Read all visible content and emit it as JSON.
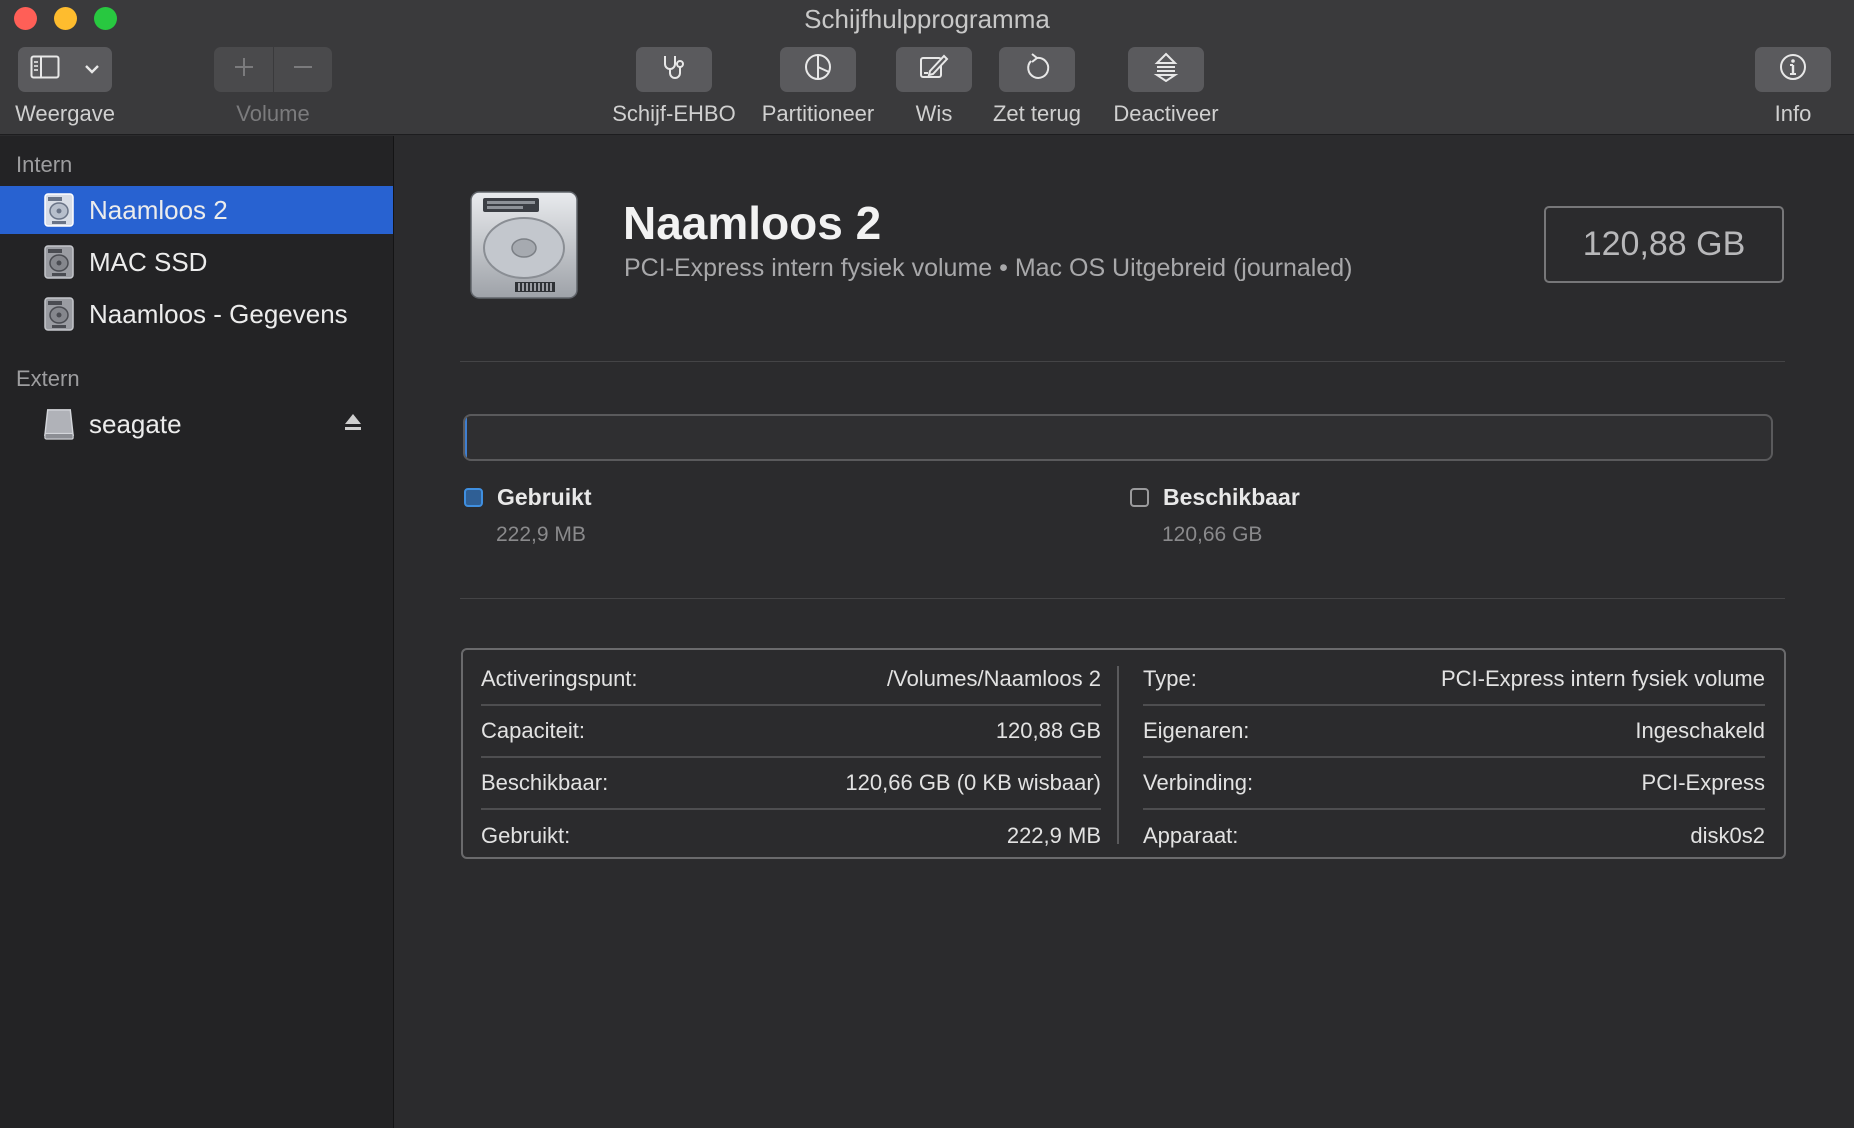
{
  "window": {
    "title": "Schijfhulpprogramma",
    "controls": [
      "close",
      "minimize",
      "zoom"
    ]
  },
  "toolbar": {
    "view": {
      "label": "Weergave",
      "icon": "sidebar-icon",
      "menu_icon": "chevron-down-icon"
    },
    "volume": {
      "label": "Volume",
      "icons": [
        "plus-icon",
        "minus-icon"
      ],
      "enabled": false
    },
    "first_aid": {
      "label": "Schijf-EHBO",
      "icon": "stethoscope-icon"
    },
    "partition": {
      "label": "Partitioneer",
      "icon": "pie-chart-icon"
    },
    "erase": {
      "label": "Wis",
      "icon": "erase-icon"
    },
    "restore": {
      "label": "Zet terug",
      "icon": "restore-icon"
    },
    "unmount": {
      "label": "Deactiveer",
      "icon": "unmount-icon"
    },
    "info": {
      "label": "Info",
      "icon": "info-icon"
    }
  },
  "sidebar": {
    "sections": [
      {
        "title": "Intern",
        "items": [
          {
            "name": "Naamloos 2",
            "icon": "internal-disk-icon",
            "selected": true
          },
          {
            "name": "MAC SSD",
            "icon": "internal-disk-icon",
            "selected": false
          },
          {
            "name": "Naamloos - Gegevens",
            "icon": "internal-disk-icon",
            "selected": false
          }
        ]
      },
      {
        "title": "Extern",
        "items": [
          {
            "name": "seagate",
            "icon": "external-disk-icon",
            "selected": false,
            "eject_icon": "eject-icon"
          }
        ]
      }
    ]
  },
  "volume": {
    "name": "Naamloos 2",
    "subtitle": "PCI-Express intern fysiek volume • Mac OS Uitgebreid (journaled)",
    "capacity": "120,88 GB"
  },
  "usage": {
    "used_fraction": 0.0018,
    "used": {
      "label": "Gebruikt",
      "value": "222,9 MB"
    },
    "free": {
      "label": "Beschikbaar",
      "value": "120,66 GB"
    },
    "used_color": "#3f7fd1"
  },
  "details": {
    "left": [
      {
        "key": "Activeringspunt:",
        "value": "/Volumes/Naamloos 2"
      },
      {
        "key": "Capaciteit:",
        "value": "120,88 GB"
      },
      {
        "key": "Beschikbaar:",
        "value": "120,66 GB (0 KB wisbaar)"
      },
      {
        "key": "Gebruikt:",
        "value": "222,9 MB"
      }
    ],
    "right": [
      {
        "key": "Type:",
        "value": "PCI-Express intern fysiek volume"
      },
      {
        "key": "Eigenaren:",
        "value": "Ingeschakeld"
      },
      {
        "key": "Verbinding:",
        "value": "PCI-Express"
      },
      {
        "key": "Apparaat:",
        "value": "disk0s2"
      }
    ]
  },
  "colors": {
    "selection": "#2862d1",
    "window_bg": "#2b2b2d",
    "sidebar_bg": "#232325"
  }
}
